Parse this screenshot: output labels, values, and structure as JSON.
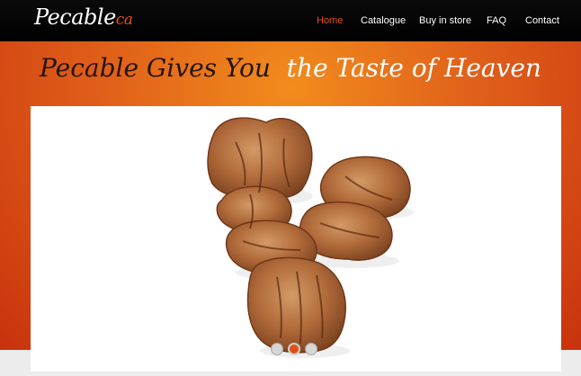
{
  "header": {
    "logo": {
      "main": "Pecable",
      "tld": "ca"
    },
    "nav": [
      {
        "label": "Home",
        "active": true
      },
      {
        "label": "Catalogue",
        "active": false
      },
      {
        "label": "Buy in store",
        "active": false
      },
      {
        "label": "FAQ",
        "active": false
      },
      {
        "label": "Contact",
        "active": false
      }
    ]
  },
  "hero": {
    "tagline_part1": "Pecable Gives You",
    "tagline_part2": "the Taste of Heaven",
    "slider": {
      "image": "candied-pecans-photo",
      "slide_count": 3,
      "active_slide": 2
    }
  },
  "colors": {
    "nav_bg": "#000000",
    "accent": "#e2501a",
    "hero_light": "#f28c1c",
    "hero_dark": "#c8320d"
  }
}
